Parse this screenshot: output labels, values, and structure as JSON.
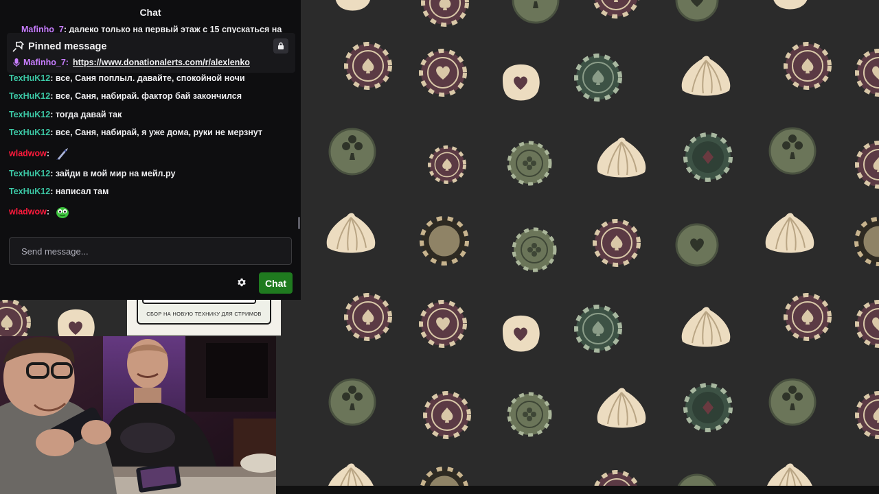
{
  "chat": {
    "title": "Chat",
    "cut_line": {
      "user": "Mafinho_7",
      "text": "далеко только на первый этаж с 15 спускаться на"
    },
    "pinned": {
      "title": "Pinned message",
      "user": "Mafinho_7:",
      "link": "https://www.donationalerts.com/r/alexlenko"
    },
    "messages": [
      {
        "user": "TexHuK12",
        "text": ": все, Саня поплыл. давайте, спокойной ночи"
      },
      {
        "user": "TexHuK12",
        "text": ": все, Саня, набирай. фактор бай закончился"
      },
      {
        "user": "TexHuK12",
        "text": ": тогда давай так"
      },
      {
        "user": "TexHuK12",
        "text": ": все, Саня, набирай, я уже дома, руки не мерзнут"
      },
      {
        "user": "wladwow",
        "text": ":",
        "emote": "rocket-emote"
      },
      {
        "user": "TexHuK12",
        "text": ": зайди в мой мир на мейл.ру"
      },
      {
        "user": "TexHuK12",
        "text": ": написал там"
      },
      {
        "user": "wladwow",
        "text": ":",
        "emote": "green-monster-emote"
      }
    ],
    "input_placeholder": "Send message...",
    "send_button": "Chat"
  },
  "donation_widget": {
    "text": "СБОР НА НОВУЮ ТЕХНИКУ ДЛЯ СТРИМОВ"
  },
  "colors": {
    "background": "#2b2b2b",
    "chip_red": "#5b3a44",
    "chip_green": "#3d5245",
    "dumpling": "#ecdcc0",
    "username_green": "#3cc9a6",
    "username_red": "#ff1a3c",
    "username_purple": "#c77dff",
    "chat_button": "#1f7a1f"
  },
  "icons": [
    "pin-icon",
    "lock-icon",
    "microphone-icon",
    "settings-icon"
  ]
}
